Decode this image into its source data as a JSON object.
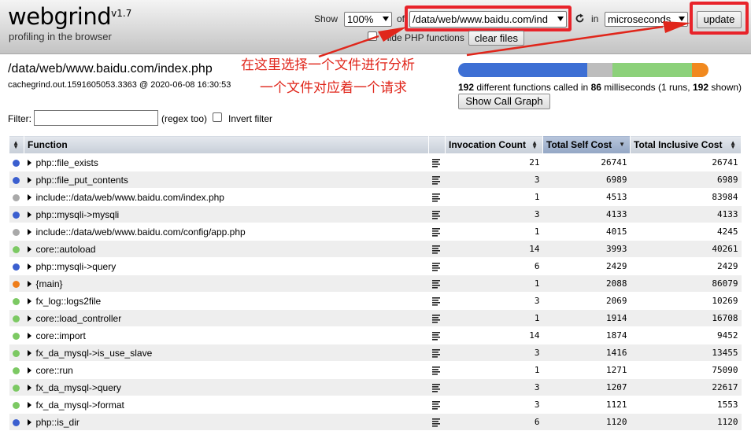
{
  "header": {
    "logo": "webgrind",
    "version": "v1.7",
    "tagline": "profiling in the browser",
    "show_label": "Show",
    "percent_value": "100%",
    "of_label": "of",
    "file_value": "/data/web/www.baidu.com/ind",
    "in_label": "in",
    "unit_value": "microseconds",
    "update_label": "update",
    "hide_php_label": "Hide PHP functions",
    "clear_files_label": "clear files"
  },
  "annotation": {
    "line1": "在这里选择一个文件进行分析",
    "line2": "一个文件对应着一个请求",
    "color": "#e0261b"
  },
  "file": {
    "path": "/data/web/www.baidu.com/index.php",
    "info": "cachegrind.out.1591605053.3363 @ 2020-06-08 16:30:53"
  },
  "summary": {
    "functions": "192",
    "mid1": " different functions called in ",
    "ms": "86",
    "mid2": " milliseconds (1 runs, ",
    "shown": "192",
    "end": " shown)",
    "call_graph_label": "Show Call Graph"
  },
  "cost_bar": [
    {
      "fraction": 0.516,
      "color": "#3d6fd4"
    },
    {
      "fraction": 0.1,
      "color": "#bdbdbd"
    },
    {
      "fraction": 0.318,
      "color": "#8cd17a"
    },
    {
      "fraction": 0.066,
      "color": "#f1891f"
    }
  ],
  "filter": {
    "label": "Filter:",
    "value": "",
    "regex_label": "(regex too)",
    "invert_label": "Invert filter"
  },
  "table": {
    "columns": [
      "Function",
      "Invocation Count",
      "Total Self Cost",
      "Total Inclusive Cost"
    ],
    "sorted_column": "Total Self Cost",
    "rows": [
      {
        "color": "#3b5fcf",
        "name": "php::file_exists",
        "count": "21",
        "self": "26741",
        "incl": "26741"
      },
      {
        "color": "#3b5fcf",
        "name": "php::file_put_contents",
        "count": "3",
        "self": "6989",
        "incl": "6989"
      },
      {
        "color": "#a9a9a9",
        "name": "include::/data/web/www.baidu.com/index.php",
        "count": "1",
        "self": "4513",
        "incl": "83984"
      },
      {
        "color": "#3b5fcf",
        "name": "php::mysqli->mysqli",
        "count": "3",
        "self": "4133",
        "incl": "4133"
      },
      {
        "color": "#a9a9a9",
        "name": "include::/data/web/www.baidu.com/config/app.php",
        "count": "1",
        "self": "4015",
        "incl": "4245"
      },
      {
        "color": "#7cc963",
        "name": "core::autoload",
        "count": "14",
        "self": "3993",
        "incl": "40261"
      },
      {
        "color": "#3b5fcf",
        "name": "php::mysqli->query",
        "count": "6",
        "self": "2429",
        "incl": "2429"
      },
      {
        "color": "#ee7d1a",
        "name": "{main}",
        "count": "1",
        "self": "2088",
        "incl": "86079"
      },
      {
        "color": "#7cc963",
        "name": "fx_log::logs2file",
        "count": "3",
        "self": "2069",
        "incl": "10269"
      },
      {
        "color": "#7cc963",
        "name": "core::load_controller",
        "count": "1",
        "self": "1914",
        "incl": "16708"
      },
      {
        "color": "#7cc963",
        "name": "core::import",
        "count": "14",
        "self": "1874",
        "incl": "9452"
      },
      {
        "color": "#7cc963",
        "name": "fx_da_mysql->is_use_slave",
        "count": "3",
        "self": "1416",
        "incl": "13455"
      },
      {
        "color": "#7cc963",
        "name": "core::run",
        "count": "1",
        "self": "1271",
        "incl": "75090"
      },
      {
        "color": "#7cc963",
        "name": "fx_da_mysql->query",
        "count": "3",
        "self": "1207",
        "incl": "22617"
      },
      {
        "color": "#7cc963",
        "name": "fx_da_mysql->format",
        "count": "3",
        "self": "1121",
        "incl": "1553"
      },
      {
        "color": "#3b5fcf",
        "name": "php::is_dir",
        "count": "6",
        "self": "1120",
        "incl": "1120"
      }
    ]
  }
}
